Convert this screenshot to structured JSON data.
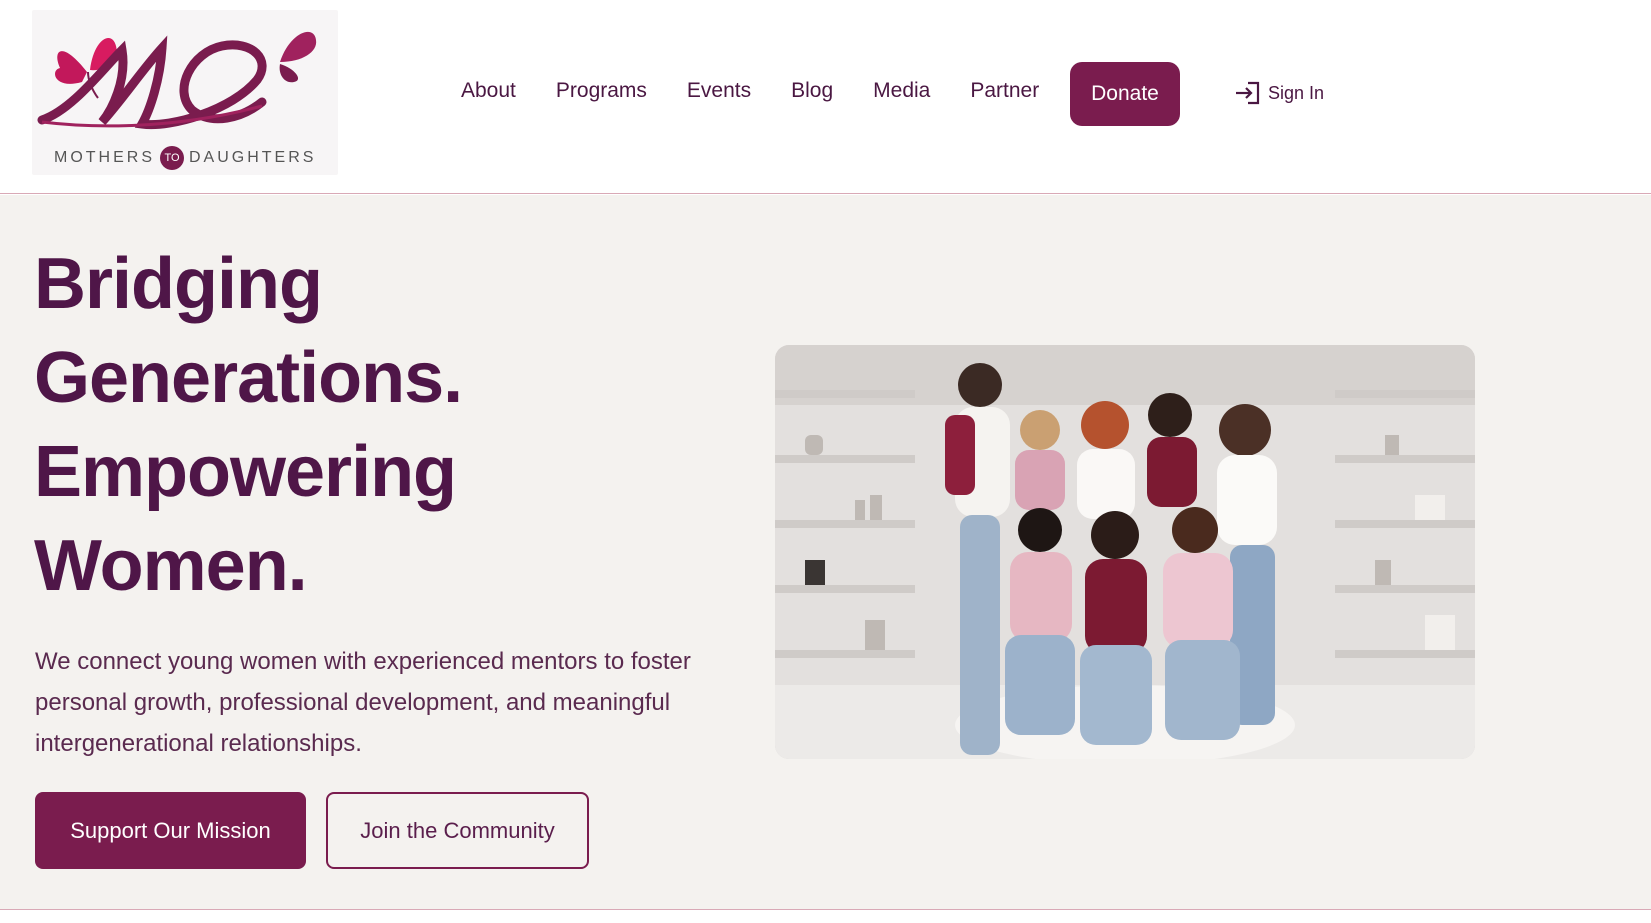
{
  "header": {
    "logo_text_left": "MOTHERS",
    "logo_text_to": "TO",
    "logo_text_right": "DAUGHTERS",
    "nav": [
      "About",
      "Programs",
      "Events",
      "Blog",
      "Media",
      "Partner"
    ],
    "donate_label": "Donate",
    "signin_label": "Sign In"
  },
  "hero": {
    "headline": [
      "Bridging",
      "Generations.",
      "Empowering",
      "Women."
    ],
    "description": "We connect young women with experienced mentors to foster personal growth, professional development, and meaningful intergenerational relationships.",
    "primary_button": "Support Our Mission",
    "secondary_button": "Join the Community"
  },
  "colors": {
    "brand": "#7a1c4e",
    "headline": "#4f1648",
    "hero_bg": "#f4f2ef",
    "divider": "#d9a9b6"
  },
  "icons": {
    "signin": "sign-in-icon",
    "logo_butterflies": "butterfly-icon"
  }
}
